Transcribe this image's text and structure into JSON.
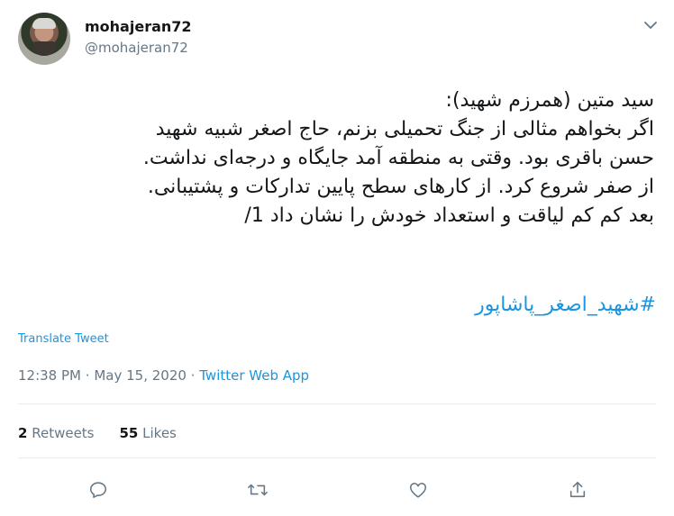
{
  "author": {
    "display_name": "mohajeran72",
    "handle": "@mohajeran72"
  },
  "tweet": {
    "text": "سید متین (همرزم شهید):\nاگر بخواهم مثالی از جنگ تحمیلی بزنم، حاج اصغر شبیه شهید\nحسن باقری بود. وقتی به منطقه آمد جایگاه و درجه‌ای نداشت.\nاز صفر شروع کرد. از کارهای سطح پایین تدارکات و پشتیبانی.\nبعد کم کم لیاقت و استعداد خودش را نشان داد 1/",
    "hashtag": "#شهید_اصغر_پاشاپور",
    "translate_label": "Translate Tweet",
    "time": "12:38 PM",
    "date": "May 15, 2020",
    "separator": "·",
    "source": "Twitter Web App"
  },
  "stats": {
    "retweets_count": "2",
    "retweets_label": "Retweets",
    "likes_count": "55",
    "likes_label": "Likes"
  },
  "actions": {
    "reply_icon": "reply-icon",
    "retweet_icon": "retweet-icon",
    "like_icon": "like-icon",
    "share_icon": "share-icon"
  },
  "colors": {
    "link": "#1b95e0",
    "secondary": "#657786",
    "text": "#14171a"
  }
}
